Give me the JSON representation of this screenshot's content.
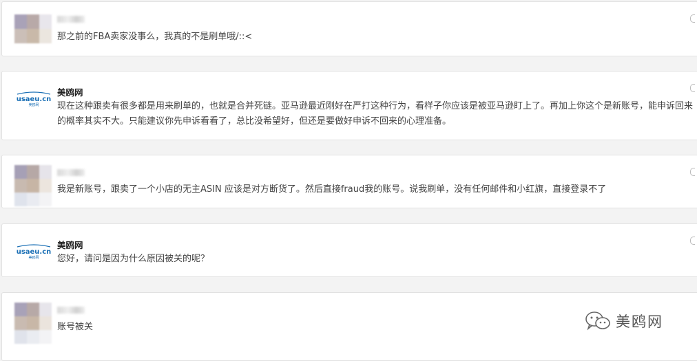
{
  "comments": [
    {
      "author": "",
      "avatar": "blurred",
      "text": "那之前的FBA卖家没事么，我真的不是刷单哦/::<"
    },
    {
      "author": "美鸥网",
      "avatar": "usaeu-logo",
      "text": "现在这种跟卖有很多都是用来刷单的，也就是合并死链。亚马逊最近刚好在严打这种行为，看样子你应该是被亚马逊盯上了。再加上你这个是新账号，能申诉回来的概率其实不大。只能建议你先申诉看看了，总比没希望好，但还是要做好申诉不回来的心理准备。"
    },
    {
      "author": "",
      "avatar": "blurred",
      "text": "我是新账号，跟卖了一个小店的无主ASIN 应该是对方断货了。然后直接fraud我的账号。说我刷单，没有任何邮件和小红旗，直接登录不了"
    },
    {
      "author": "美鸥网",
      "avatar": "usaeu-logo",
      "text": "您好，请问是因为什么原因被关的呢？"
    },
    {
      "author": "",
      "avatar": "blurred",
      "text": "账号被关"
    }
  ],
  "logo": {
    "text": "usaeu.cn",
    "subtext": "美鸥网",
    "color": "#1a6fb5"
  },
  "watermark": {
    "text": "美鸥网",
    "icon": "wechat-icon"
  }
}
